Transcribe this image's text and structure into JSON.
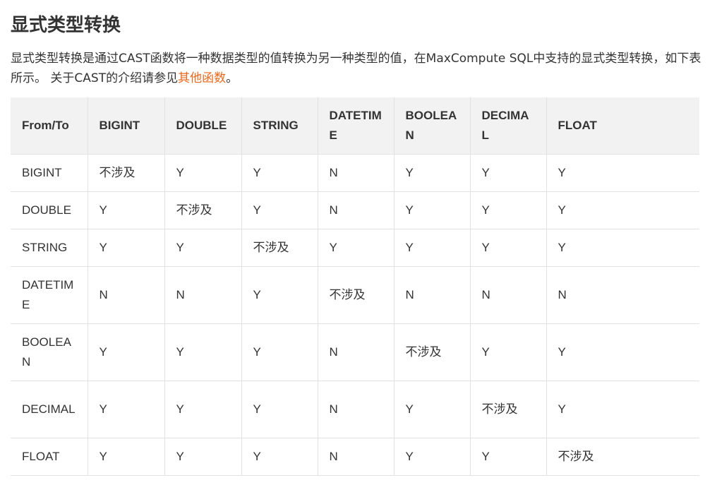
{
  "heading": "显式类型转换",
  "intro": {
    "text_before_link": "显式类型转换是通过CAST函数将一种数据类型的值转换为另一种类型的值，在MaxCompute SQL中支持的显式类型转换，如下表所示。 关于CAST的介绍请参见",
    "link_text": "其他函数",
    "text_after_link": "。"
  },
  "table": {
    "headers": [
      "From/To",
      "BIGINT",
      "DOUBLE",
      "STRING",
      "DATETIME",
      "BOOLEAN",
      "DECIMAL",
      "FLOAT"
    ],
    "rows": [
      [
        "BIGINT",
        "不涉及",
        "Y",
        "Y",
        "N",
        "Y",
        "Y",
        "Y"
      ],
      [
        "DOUBLE",
        "Y",
        "不涉及",
        "Y",
        "N",
        "Y",
        "Y",
        "Y"
      ],
      [
        "STRING",
        "Y",
        "Y",
        "不涉及",
        "Y",
        "Y",
        "Y",
        "Y"
      ],
      [
        "DATETIME",
        "N",
        "N",
        "Y",
        "不涉及",
        "N",
        "N",
        "N"
      ],
      [
        "BOOLEAN",
        "Y",
        "Y",
        "Y",
        "N",
        "不涉及",
        "Y",
        "Y"
      ],
      [
        "DECIMAL",
        "Y",
        "Y",
        "Y",
        "N",
        "Y",
        "不涉及",
        "Y"
      ],
      [
        "FLOAT",
        "Y",
        "Y",
        "Y",
        "N",
        "Y",
        "Y",
        "不涉及"
      ]
    ]
  },
  "colors": {
    "link": "#e8691e",
    "header_bg": "#f2f2f2",
    "border": "#e2e2e2",
    "text": "#333333"
  }
}
